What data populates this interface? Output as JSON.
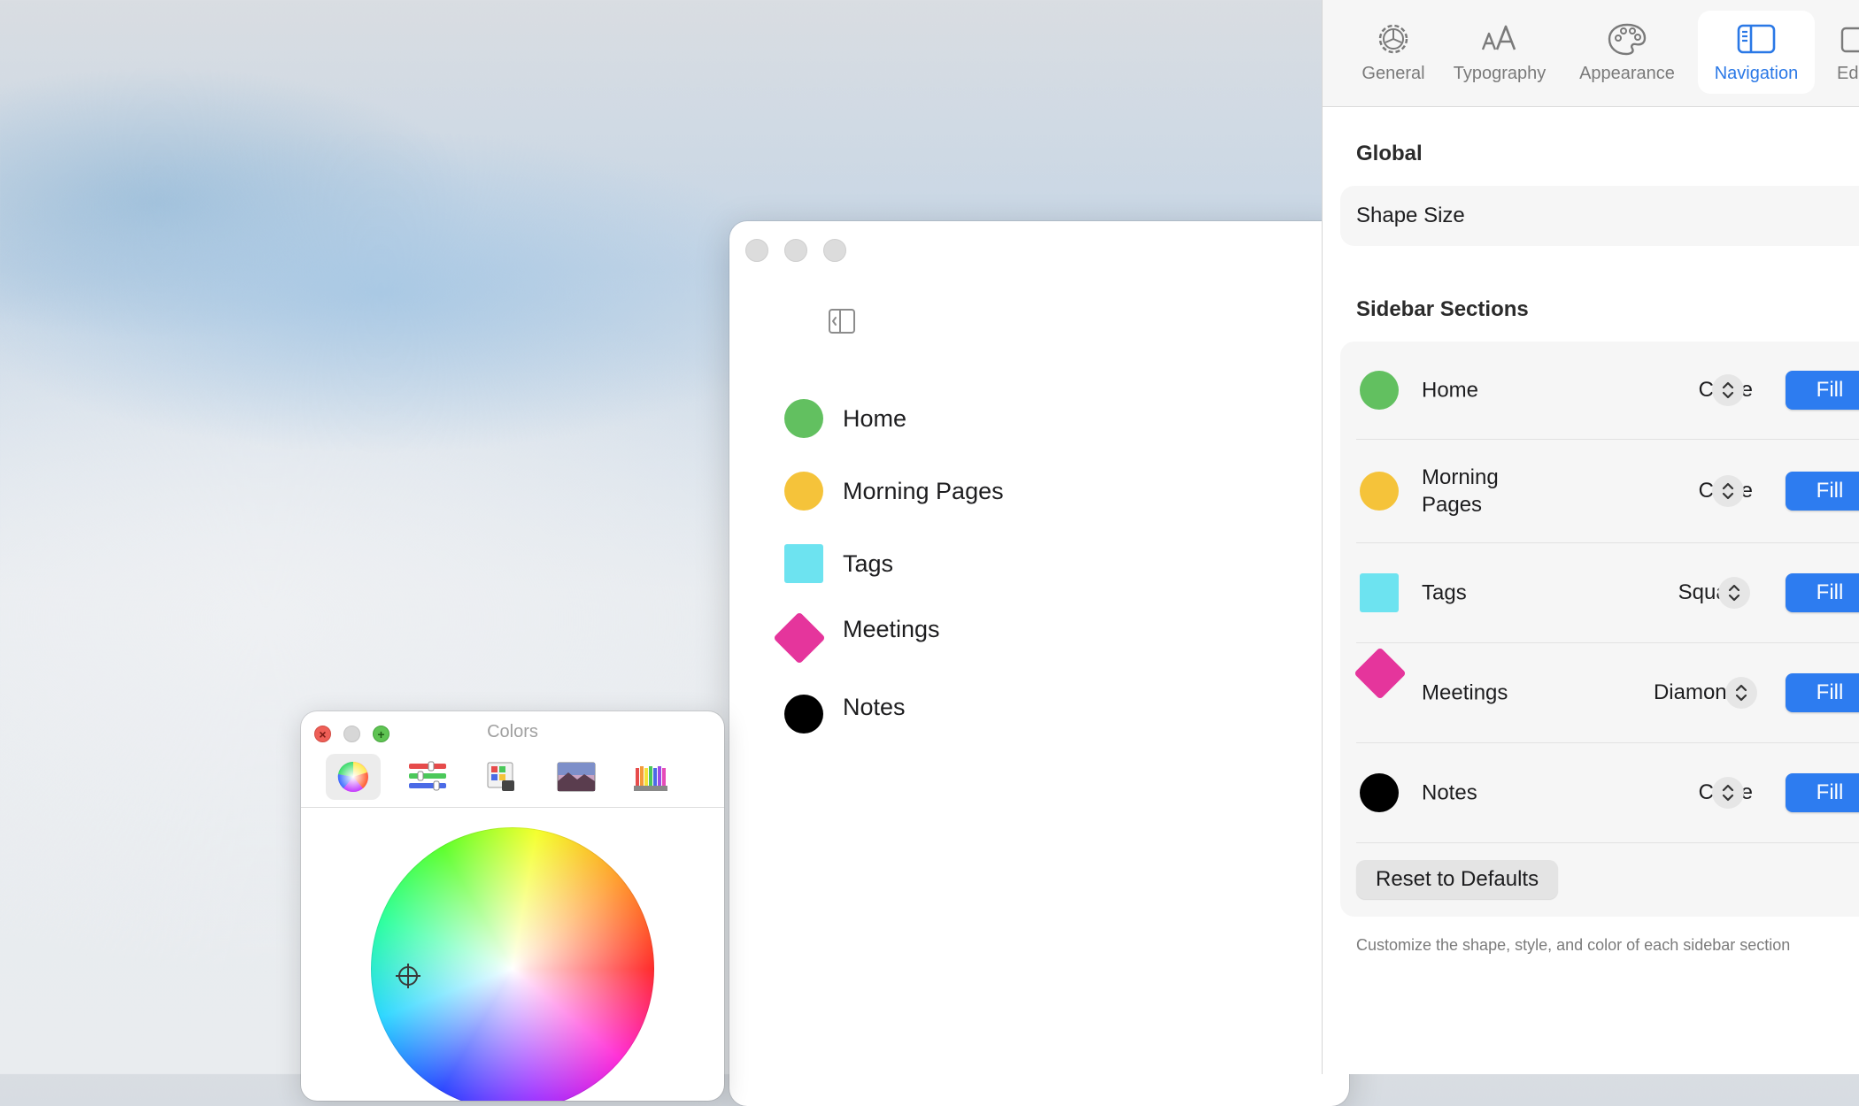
{
  "main_window": {
    "sidebar_items": [
      {
        "label": "Home",
        "shape": "circle",
        "color": "#62c060"
      },
      {
        "label": "Morning Pages",
        "shape": "circle",
        "color": "#f5c33a"
      },
      {
        "label": "Tags",
        "shape": "square",
        "color": "#6de3f0"
      },
      {
        "label": "Meetings",
        "shape": "diamond",
        "color": "#e5359c"
      },
      {
        "label": "Notes",
        "shape": "circle",
        "color": "#000000"
      }
    ]
  },
  "colors_panel": {
    "title": "Colors",
    "modes": [
      "color-wheel",
      "color-sliders",
      "color-palettes",
      "image-palettes",
      "pencils"
    ],
    "active_mode": "color-wheel"
  },
  "settings": {
    "tabs": [
      {
        "label": "General",
        "icon": "gear-icon"
      },
      {
        "label": "Typography",
        "icon": "typography-icon"
      },
      {
        "label": "Appearance",
        "icon": "palette-icon"
      },
      {
        "label": "Navigation",
        "icon": "sidebar-icon",
        "active": true
      },
      {
        "label": "Ed",
        "icon": "editor-icon"
      }
    ],
    "global_title": "Global",
    "shape_size_label": "Shape Size",
    "sidebar_sections_title": "Sidebar Sections",
    "rows": [
      {
        "label": "Home",
        "shape_value": "Circle",
        "style": "Fill",
        "shape": "circle",
        "color": "#62c060"
      },
      {
        "label": "Morning Pages",
        "shape_value": "Circle",
        "style": "Fill",
        "shape": "circle",
        "color": "#f5c33a"
      },
      {
        "label": "Tags",
        "shape_value": "Square",
        "style": "Fill",
        "shape": "square",
        "color": "#6de3f0"
      },
      {
        "label": "Meetings",
        "shape_value": "Diamond",
        "style": "Fill",
        "shape": "diamond",
        "color": "#e5359c"
      },
      {
        "label": "Notes",
        "shape_value": "Circle",
        "style": "Fill",
        "shape": "circle",
        "color": "#000000"
      }
    ],
    "reset_label": "Reset to Defaults",
    "footnote": "Customize the shape, style, and color of each sidebar section"
  }
}
